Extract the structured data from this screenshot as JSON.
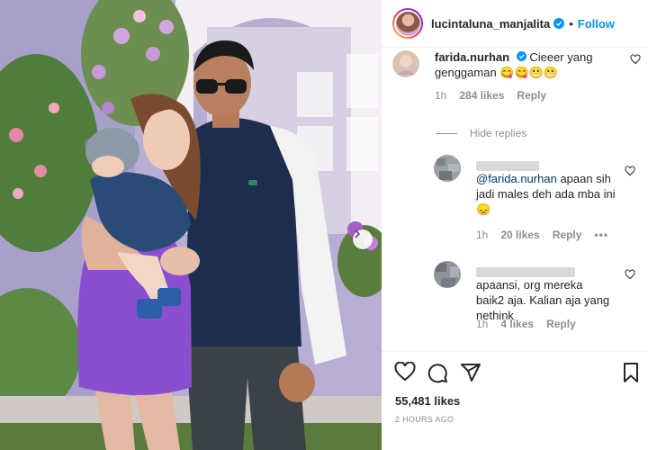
{
  "post": {
    "username": "lucintaluna_manjalita",
    "follow_label": "Follow",
    "separator": "•",
    "likes": "55,481 likes",
    "timestamp": "2 HOURS AGO"
  },
  "comments": [
    {
      "username": "farida.nurhan",
      "text": "Cieeer yang genggaman",
      "emojis": "😋😋😬😬",
      "time": "1h",
      "likes": "284 likes",
      "reply_label": "Reply"
    }
  ],
  "hide_replies_label": "Hide replies",
  "replies": [
    {
      "mention": "@farida.nurhan",
      "text": "apaan sih jadi males deh ada mba ini",
      "emoji": "😞",
      "time": "1h",
      "likes": "20 likes",
      "reply_label": "Reply",
      "more": "•••"
    },
    {
      "text": "apaansi, org mereka baik2 aja. Kalian aja yang nethink",
      "time": "1h",
      "likes": "4 likes",
      "reply_label": "Reply"
    }
  ],
  "colors": {
    "accent": "#0095f6",
    "mention": "#00376b",
    "meta": "#8e8e8e",
    "dress": "#8a4fd1"
  },
  "icons": [
    "verified-badge-icon",
    "heart-icon",
    "comment-icon",
    "share-icon",
    "bookmark-icon",
    "next-arrow-icon",
    "more-icon"
  ]
}
